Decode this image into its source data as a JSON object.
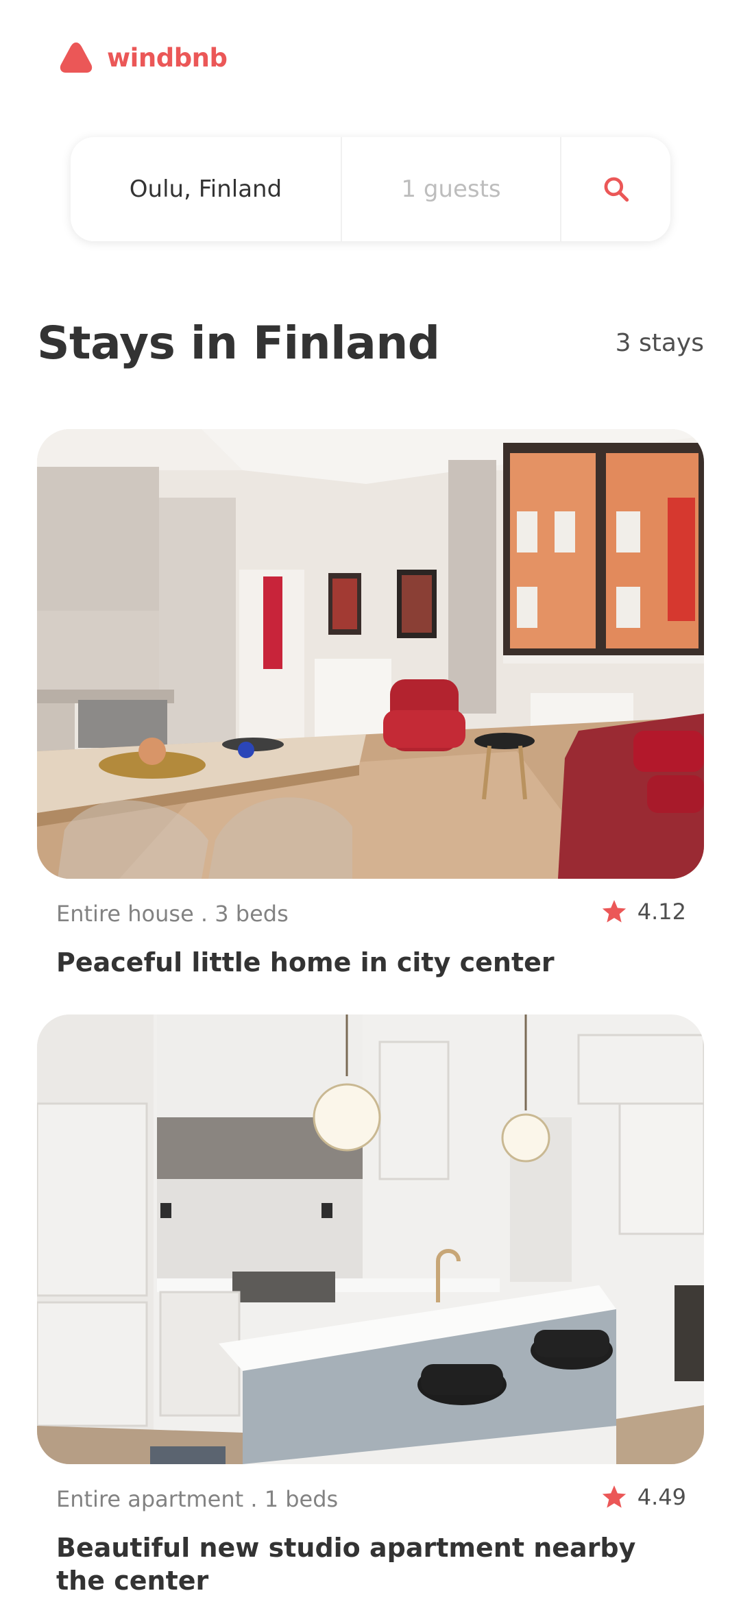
{
  "brand": {
    "name": "windbnb",
    "logo_icon": "triangle-logo-icon",
    "accent_color": "#EB5757"
  },
  "search": {
    "location": "Oulu, Finland",
    "guests": "1 guests",
    "button_icon": "search-icon"
  },
  "results": {
    "title": "Stays in Finland",
    "count_label": "3 stays"
  },
  "stays": [
    {
      "type_label": "Entire house . 3 beds",
      "rating": "4.12",
      "title": "Peaceful little home in city center",
      "photo_icon": "living-room-photo"
    },
    {
      "type_label": "Entire apartment . 1 beds",
      "rating": "4.49",
      "title": "Beautiful new studio apartment nearby the center",
      "photo_icon": "kitchen-photo"
    }
  ]
}
